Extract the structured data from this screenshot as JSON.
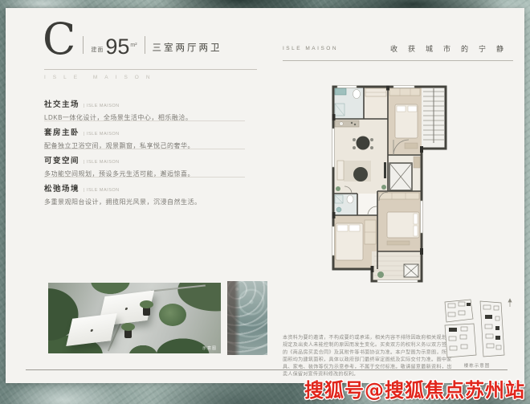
{
  "header": {
    "unit_letter": "C",
    "area_prefix": "建面",
    "area_value": "95",
    "area_unit": "m²",
    "layout": "三室两厅两卫",
    "brand_spaced": "ISLE MAISON"
  },
  "right_header": {
    "brand": "ISLE MAISON",
    "slogan": "收获城市的宁静"
  },
  "features": [
    {
      "title": "社交主场",
      "suffix": "| ISLE MAISON",
      "body": "LDKB一体化设计，全场景生活中心，相乐融洽。"
    },
    {
      "title": "套房主卧",
      "suffix": "| ISLE MAISON",
      "body": "配备独立卫浴空间，观景飘窗，私享悦己的奢华。"
    },
    {
      "title": "可变空间",
      "suffix": "| ISLE MAISON",
      "body": "多功能空间规划，预设多元生活可能，邂逅惊喜。"
    },
    {
      "title": "松弛场境",
      "suffix": "| ISLE MAISON",
      "body": "多重景观阳台设计，拥揽阳光风景，沉浸自然生活。"
    }
  ],
  "photo": {
    "caption": "示意图"
  },
  "disclaimer": {
    "text": "本资料为要约邀请，不构成要约或承诺，相关内容不排除因政府相关规划、规定及出卖人未能控制的原因而发生变化。买卖双方的权利义务以双方签订的《商品房买卖合同》及其附件等书面协议为准。本户型图为示意图，所载面积均为建筑面积，具体以政府部门最终审定图纸及实际交付为准。图中家具、家电、装饰等仅为示意参考，不属于交付标准。敬请留意最新资料，出卖人保留对宣传资料修改的权利。"
  },
  "keyplan": {
    "caption": "楼栋示意图"
  },
  "watermark": {
    "text": "搜狐号@搜狐焦点苏州站"
  },
  "colors": {
    "card_bg": "#f4f3f0",
    "texture_base": "#879c96",
    "wall": "#45443e",
    "wet_area_teal": "#9fc0bd",
    "watermark_red": "#e1251b"
  }
}
